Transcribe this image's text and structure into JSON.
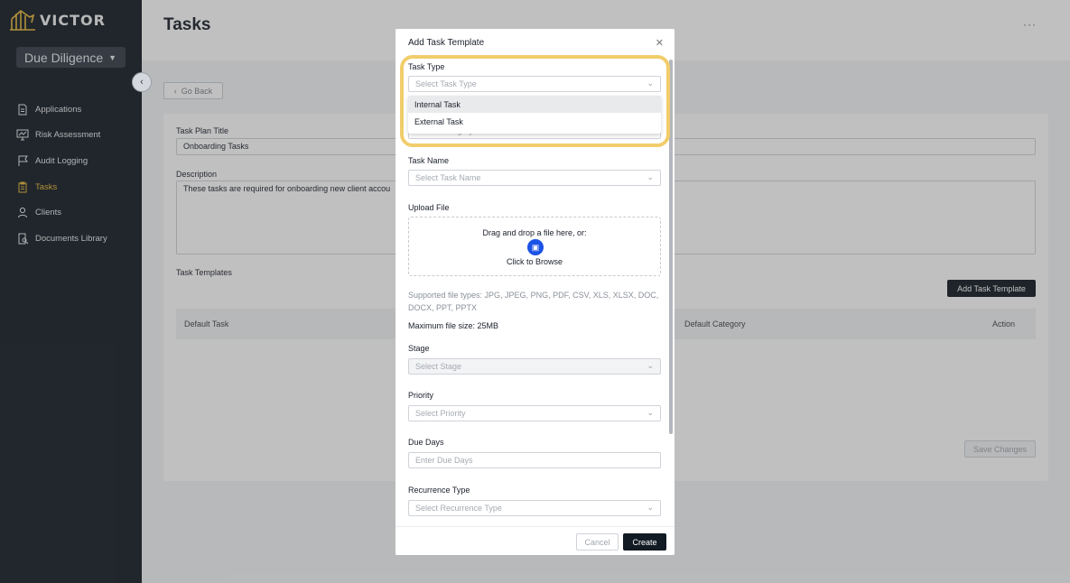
{
  "brand": {
    "name": "VICTOR",
    "accent": "#e8b93a"
  },
  "sidebar": {
    "module": "Due Diligence",
    "items": [
      {
        "label": "Applications",
        "icon": "document-icon"
      },
      {
        "label": "Risk Assessment",
        "icon": "chart-monitor-icon"
      },
      {
        "label": "Audit Logging",
        "icon": "flag-icon"
      },
      {
        "label": "Tasks",
        "icon": "clipboard-icon",
        "active": true
      },
      {
        "label": "Clients",
        "icon": "user-icon"
      },
      {
        "label": "Documents Library",
        "icon": "doc-search-icon"
      }
    ]
  },
  "header": {
    "title": "Tasks"
  },
  "page": {
    "go_back": "Go Back",
    "task_plan_title_label": "Task Plan Title",
    "task_plan_title_value": "Onboarding Tasks",
    "description_label": "Description",
    "description_value": "These tasks are required for onboarding new client accou",
    "task_templates_label": "Task Templates",
    "add_template_button": "Add Task Template",
    "table_headers": [
      "Default Task",
      "Default Category",
      "Action"
    ],
    "save_changes": "Save Changes"
  },
  "modal": {
    "title": "Add Task Template",
    "task_type_label": "Task Type",
    "task_type_placeholder": "Select Task Type",
    "task_type_options": [
      "Internal Task",
      "External Task"
    ],
    "category_placeholder_partial": "Select Category",
    "task_name_label": "Task Name",
    "task_name_placeholder": "Select Task Name",
    "upload_label": "Upload File",
    "upload_line1": "Drag and drop a file here, or:",
    "upload_line2": "Click to Browse",
    "supported_types": "Supported file types: JPG, JPEG, PNG, PDF, CSV, XLS, XLSX, DOC, DOCX, PPT, PPTX",
    "max_size": "Maximum file size: 25MB",
    "stage_label": "Stage",
    "stage_placeholder": "Select Stage",
    "priority_label": "Priority",
    "priority_placeholder": "Select Priority",
    "due_days_label": "Due Days",
    "due_days_placeholder": "Enter Due Days",
    "recurrence_label": "Recurrence Type",
    "recurrence_placeholder": "Select Recurrence Type",
    "cancel": "Cancel",
    "create": "Create"
  }
}
